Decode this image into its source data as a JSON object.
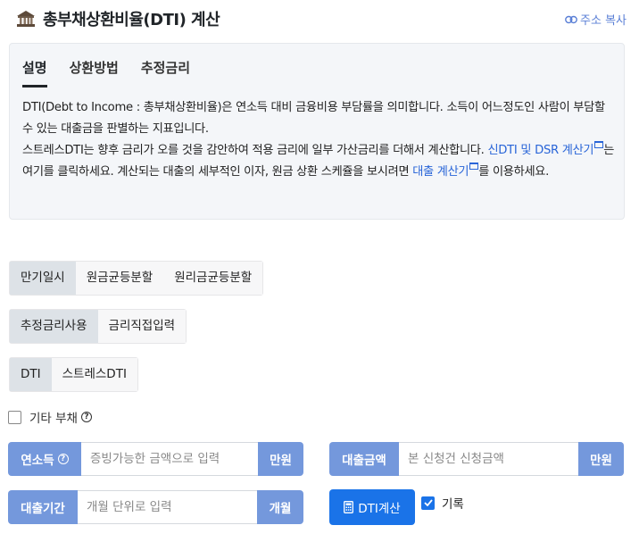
{
  "header": {
    "title": "총부채상환비율(DTI) 계산",
    "share_label": "주소 복사"
  },
  "info": {
    "tabs": [
      "설명",
      "상환방법",
      "추정금리"
    ],
    "active_tab": "설명",
    "para1": "DTI(Debt to Income : 총부채상환비율)은 연소득 대비 금융비용 부담률을 의미합니다. 소득이 어느정도인 사람이 부담할 수 있는 대출금을 판별하는 지표입니다.",
    "para2_a": "스트레스DTI는 향후 금리가 오를 것을 감안하여 적용 금리에 일부 가산금리를 더해서 계산합니다. ",
    "link1": "신DTI 및 DSR 계산기",
    "para2_b": "는 여기를 클릭하세요. 계산되는 대출의 세부적인 이자, 원금 상환 스케쥴을 보시려면 ",
    "link2": "대출 계산기",
    "para2_c": "를 이용하세요."
  },
  "repayment": {
    "options": [
      "만기일시",
      "원금균등분할",
      "원리금균등분할"
    ],
    "selected": "만기일시"
  },
  "rate_mode": {
    "options": [
      "추정금리사용",
      "금리직접입력"
    ],
    "selected": "추정금리사용"
  },
  "dti_mode": {
    "options": [
      "DTI",
      "스트레스DTI"
    ],
    "selected": "DTI"
  },
  "other_debt": {
    "label": "기타 부채",
    "checked": false
  },
  "fields": {
    "income": {
      "label": "연소득",
      "placeholder": "증빙가능한 금액으로 입력",
      "unit": "만원"
    },
    "loan_amount": {
      "label": "대출금액",
      "placeholder": "본 신청건 신청금액",
      "unit": "만원"
    },
    "loan_period": {
      "label": "대출기간",
      "placeholder": "개월 단위로 입력",
      "unit": "개월"
    }
  },
  "calc_button": "DTI계산",
  "record": {
    "label": "기록",
    "checked": true
  },
  "colors": {
    "accent": "#7498dc",
    "primary": "#1a73e8",
    "link": "#2965d8"
  }
}
